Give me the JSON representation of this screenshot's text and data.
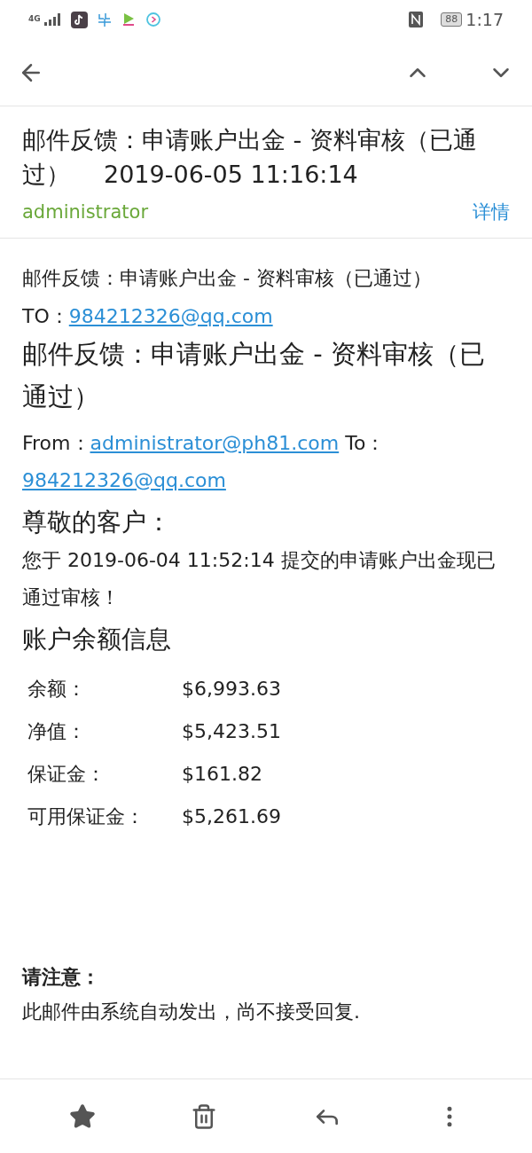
{
  "status_bar": {
    "network": "4G",
    "battery": "88",
    "time": "1:17"
  },
  "header": {
    "subject": "邮件反馈：申请账户出金 - 资料审核（已通过）",
    "date": "2019-06-05 11:16:14",
    "sender": "administrator",
    "details_link": "详情"
  },
  "body": {
    "title": "邮件反馈：申请账户出金 - 资料审核（已通过）",
    "to_label": "TO：",
    "to_email": "984212326@qq.com",
    "heading": "邮件反馈：申请账户出金 - 资料审核（已通过）",
    "from_label": "From：",
    "from_email": "administrator@ph81.com",
    "to_label_2": "To：",
    "to_email_2": "984212326@qq.com",
    "greeting": "尊敬的客户：",
    "message": "您于 2019-06-04 11:52:14 提交的申请账户出金现已通过审核！",
    "balance_heading": "账户余额信息",
    "balance_rows": [
      {
        "label": "余额：",
        "value": "$6,993.63"
      },
      {
        "label": "净值：",
        "value": "$5,423.51"
      },
      {
        "label": "保证金：",
        "value": "$161.82"
      },
      {
        "label": "可用保证金：",
        "value": "$5,261.69"
      }
    ],
    "notice_heading": "请注意：",
    "notice_text": "此邮件由系统自动发出，尚不接受回复."
  }
}
